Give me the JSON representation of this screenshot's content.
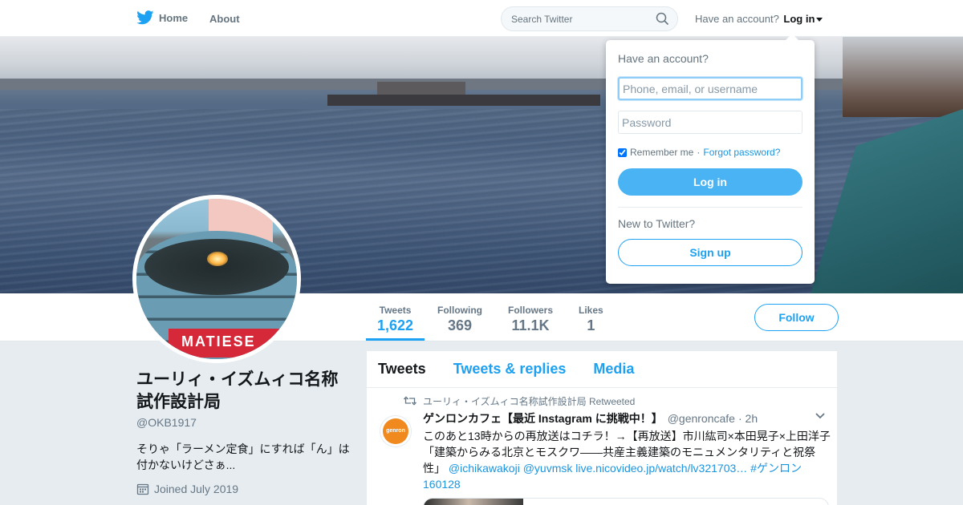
{
  "colors": {
    "brand": "#1da1f2",
    "link": "#1b95e0",
    "background": "#e6ecf0"
  },
  "nav": {
    "home_label": "Home",
    "about_label": "About",
    "search_placeholder": "Search Twitter",
    "have_account": "Have an account?",
    "login_label": "Log in"
  },
  "profile": {
    "avatar_label": "MATIESE",
    "name": "ユーリィ・イズムィコ名称試作設計局",
    "handle": "@OKB1917",
    "bio": "そりゃ「ラーメン定食」にすれば「ん」は付かないけどさぁ...",
    "joined": "Joined July 2019",
    "follow_label": "Follow"
  },
  "stats": [
    {
      "label": "Tweets",
      "value": "1,622"
    },
    {
      "label": "Following",
      "value": "369"
    },
    {
      "label": "Followers",
      "value": "11.1K"
    },
    {
      "label": "Likes",
      "value": "1"
    }
  ],
  "tabs": [
    {
      "label": "Tweets"
    },
    {
      "label": "Tweets & replies"
    },
    {
      "label": "Media"
    }
  ],
  "tweet": {
    "retweeted_by": "ユーリィ・イズムィコ名称試作設計局 Retweeted",
    "avatar_text": "genron cafe",
    "author_name": "ゲンロンカフェ【最近 Instagram に挑戦中！】",
    "author_handle": "@genroncafe",
    "time": "· 2h",
    "body_text": "このあと13時からの再放送はコチラ！→【再放送】市川紘司×本田晃子×上田洋子「建築からみる北京とモスクワ――共産主義建築のモニュメンタリティと祝祭性」",
    "mention_1": "@ichikawakoji",
    "mention_2": "@yuvmsk",
    "link": "live.nicovideo.jp/watch/lv321703…",
    "hashtag": "#ゲンロン160128"
  },
  "login_dropdown": {
    "title": "Have an account?",
    "username_placeholder": "Phone, email, or username",
    "password_placeholder": "Password",
    "remember_label": "Remember me",
    "separator": "·",
    "forgot_label": "Forgot password?",
    "login_button": "Log in",
    "new_label": "New to Twitter?",
    "signup_button": "Sign up"
  }
}
